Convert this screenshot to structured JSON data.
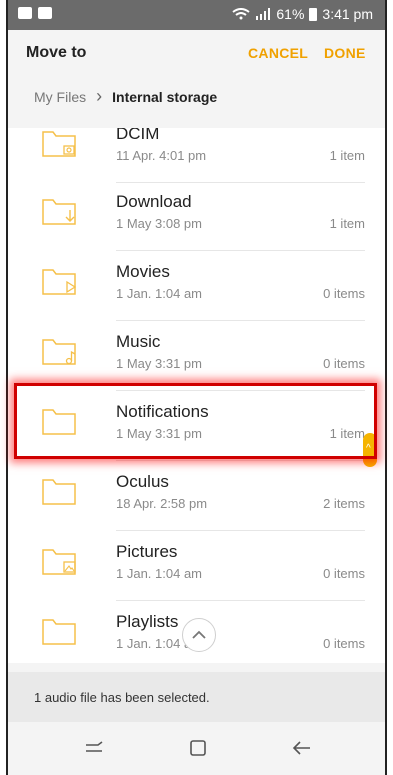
{
  "status": {
    "battery": "61%",
    "time": "3:41 pm"
  },
  "header": {
    "title": "Move to",
    "cancel": "CANCEL",
    "done": "DONE"
  },
  "breadcrumb": {
    "root": "My Files",
    "current": "Internal storage"
  },
  "folders": [
    {
      "name": "DCIM",
      "date": "11 Apr. 4:01 pm",
      "count": "1 item",
      "icon": "camera-folder-icon"
    },
    {
      "name": "Download",
      "date": "1 May 3:08 pm",
      "count": "1 item",
      "icon": "download-folder-icon"
    },
    {
      "name": "Movies",
      "date": "1 Jan. 1:04 am",
      "count": "0 items",
      "icon": "video-folder-icon"
    },
    {
      "name": "Music",
      "date": "1 May 3:31 pm",
      "count": "0 items",
      "icon": "music-folder-icon"
    },
    {
      "name": "Notifications",
      "date": "1 May 3:31 pm",
      "count": "1 item",
      "icon": "folder-icon"
    },
    {
      "name": "Oculus",
      "date": "18 Apr. 2:58 pm",
      "count": "2 items",
      "icon": "folder-icon"
    },
    {
      "name": "Pictures",
      "date": "1 Jan. 1:04 am",
      "count": "0 items",
      "icon": "image-folder-icon"
    },
    {
      "name": "Playlists",
      "date": "1 Jan. 1:04 am",
      "count": "0 items",
      "icon": "folder-icon"
    }
  ],
  "footer": {
    "message": "1 audio file has been selected."
  },
  "colors": {
    "accent": "#f0a100",
    "folder": "#f5c04a",
    "highlight": "#d00000"
  }
}
